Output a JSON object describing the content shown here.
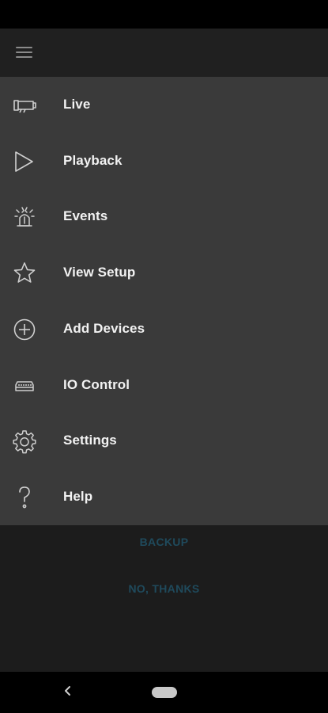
{
  "menu": {
    "items": [
      {
        "label": "Live",
        "icon": "camera-icon"
      },
      {
        "label": "Playback",
        "icon": "play-icon"
      },
      {
        "label": "Events",
        "icon": "alarm-icon"
      },
      {
        "label": "View Setup",
        "icon": "star-icon"
      },
      {
        "label": "Add Devices",
        "icon": "add-circle-icon"
      },
      {
        "label": "IO Control",
        "icon": "io-device-icon"
      },
      {
        "label": "Settings",
        "icon": "gear-icon"
      },
      {
        "label": "Help",
        "icon": "question-icon"
      }
    ]
  },
  "dialog": {
    "backup_label": "BACKUP",
    "no_thanks_label": "NO, THANKS"
  },
  "colors": {
    "drawer_bg": "#3a3a3a",
    "background": "#1c1c1c",
    "dialog_button_text": "#1f4a5c",
    "menu_text": "#f2f2f2"
  }
}
